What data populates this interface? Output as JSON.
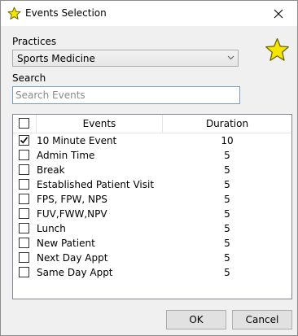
{
  "window": {
    "title": "Events Selection"
  },
  "practices": {
    "label": "Practices",
    "selected": "Sports Medicine"
  },
  "search": {
    "label": "Search",
    "placeholder": "Search Events",
    "value": ""
  },
  "table": {
    "columns": [
      "Events",
      "Duration"
    ],
    "rows": [
      {
        "event": "10 Minute Event",
        "duration": "10",
        "checked": true
      },
      {
        "event": "Admin Time",
        "duration": "5",
        "checked": false
      },
      {
        "event": "Break",
        "duration": "5",
        "checked": false
      },
      {
        "event": "Established Patient Visit",
        "duration": "5",
        "checked": false
      },
      {
        "event": "FPS, FPW, NPS",
        "duration": "5",
        "checked": false
      },
      {
        "event": "FUV,FWW,NPV",
        "duration": "5",
        "checked": false
      },
      {
        "event": "Lunch",
        "duration": "5",
        "checked": false
      },
      {
        "event": "New Patient",
        "duration": "5",
        "checked": false
      },
      {
        "event": "Next Day Appt",
        "duration": "5",
        "checked": false
      },
      {
        "event": "Same Day Appt",
        "duration": "5",
        "checked": false
      }
    ]
  },
  "buttons": {
    "ok": "OK",
    "cancel": "Cancel"
  },
  "icons": {
    "title": "star-icon",
    "favorite": "star-icon",
    "close": "close-icon",
    "dropdown": "chevron-down-icon"
  },
  "colors": {
    "star": "#f5e600",
    "star_outline": "#6b6400",
    "search_border": "#7a9dbf"
  }
}
